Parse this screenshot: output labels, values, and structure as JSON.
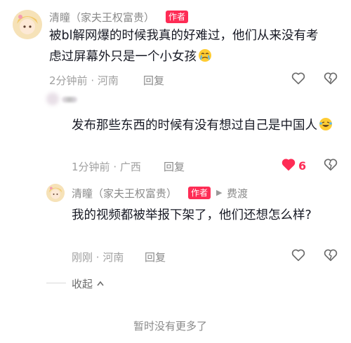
{
  "comment1": {
    "name": "清瞳（家夫王权富贵）",
    "badge": "作者",
    "text": "被bl解网爆的时候我真的好难过，他们从来没有考虑过屏幕外只是一个小女孩",
    "emoji": "crying-face",
    "time": "2分钟前",
    "location": "河南",
    "reply_label": "回复"
  },
  "comment2": {
    "text": "发布那些东西的时候有没有想过自己是中国人",
    "emoji": "laughing-tears-face",
    "time": "1分钟前",
    "location": "广西",
    "reply_label": "回复",
    "like_count": "6",
    "liked": true
  },
  "comment3": {
    "name": "清瞳（家夫王权富贵）",
    "badge": "作者",
    "reply_target": "费渡",
    "text": "我的视频都被举报下架了，他们还想怎么样?",
    "time": "刚刚",
    "location": "河南",
    "reply_label": "回复"
  },
  "collapse_label": "收起",
  "footer_text": "暂时没有更多了",
  "colors": {
    "accent": "#fe2c55",
    "muted": "#8a8a8a"
  }
}
